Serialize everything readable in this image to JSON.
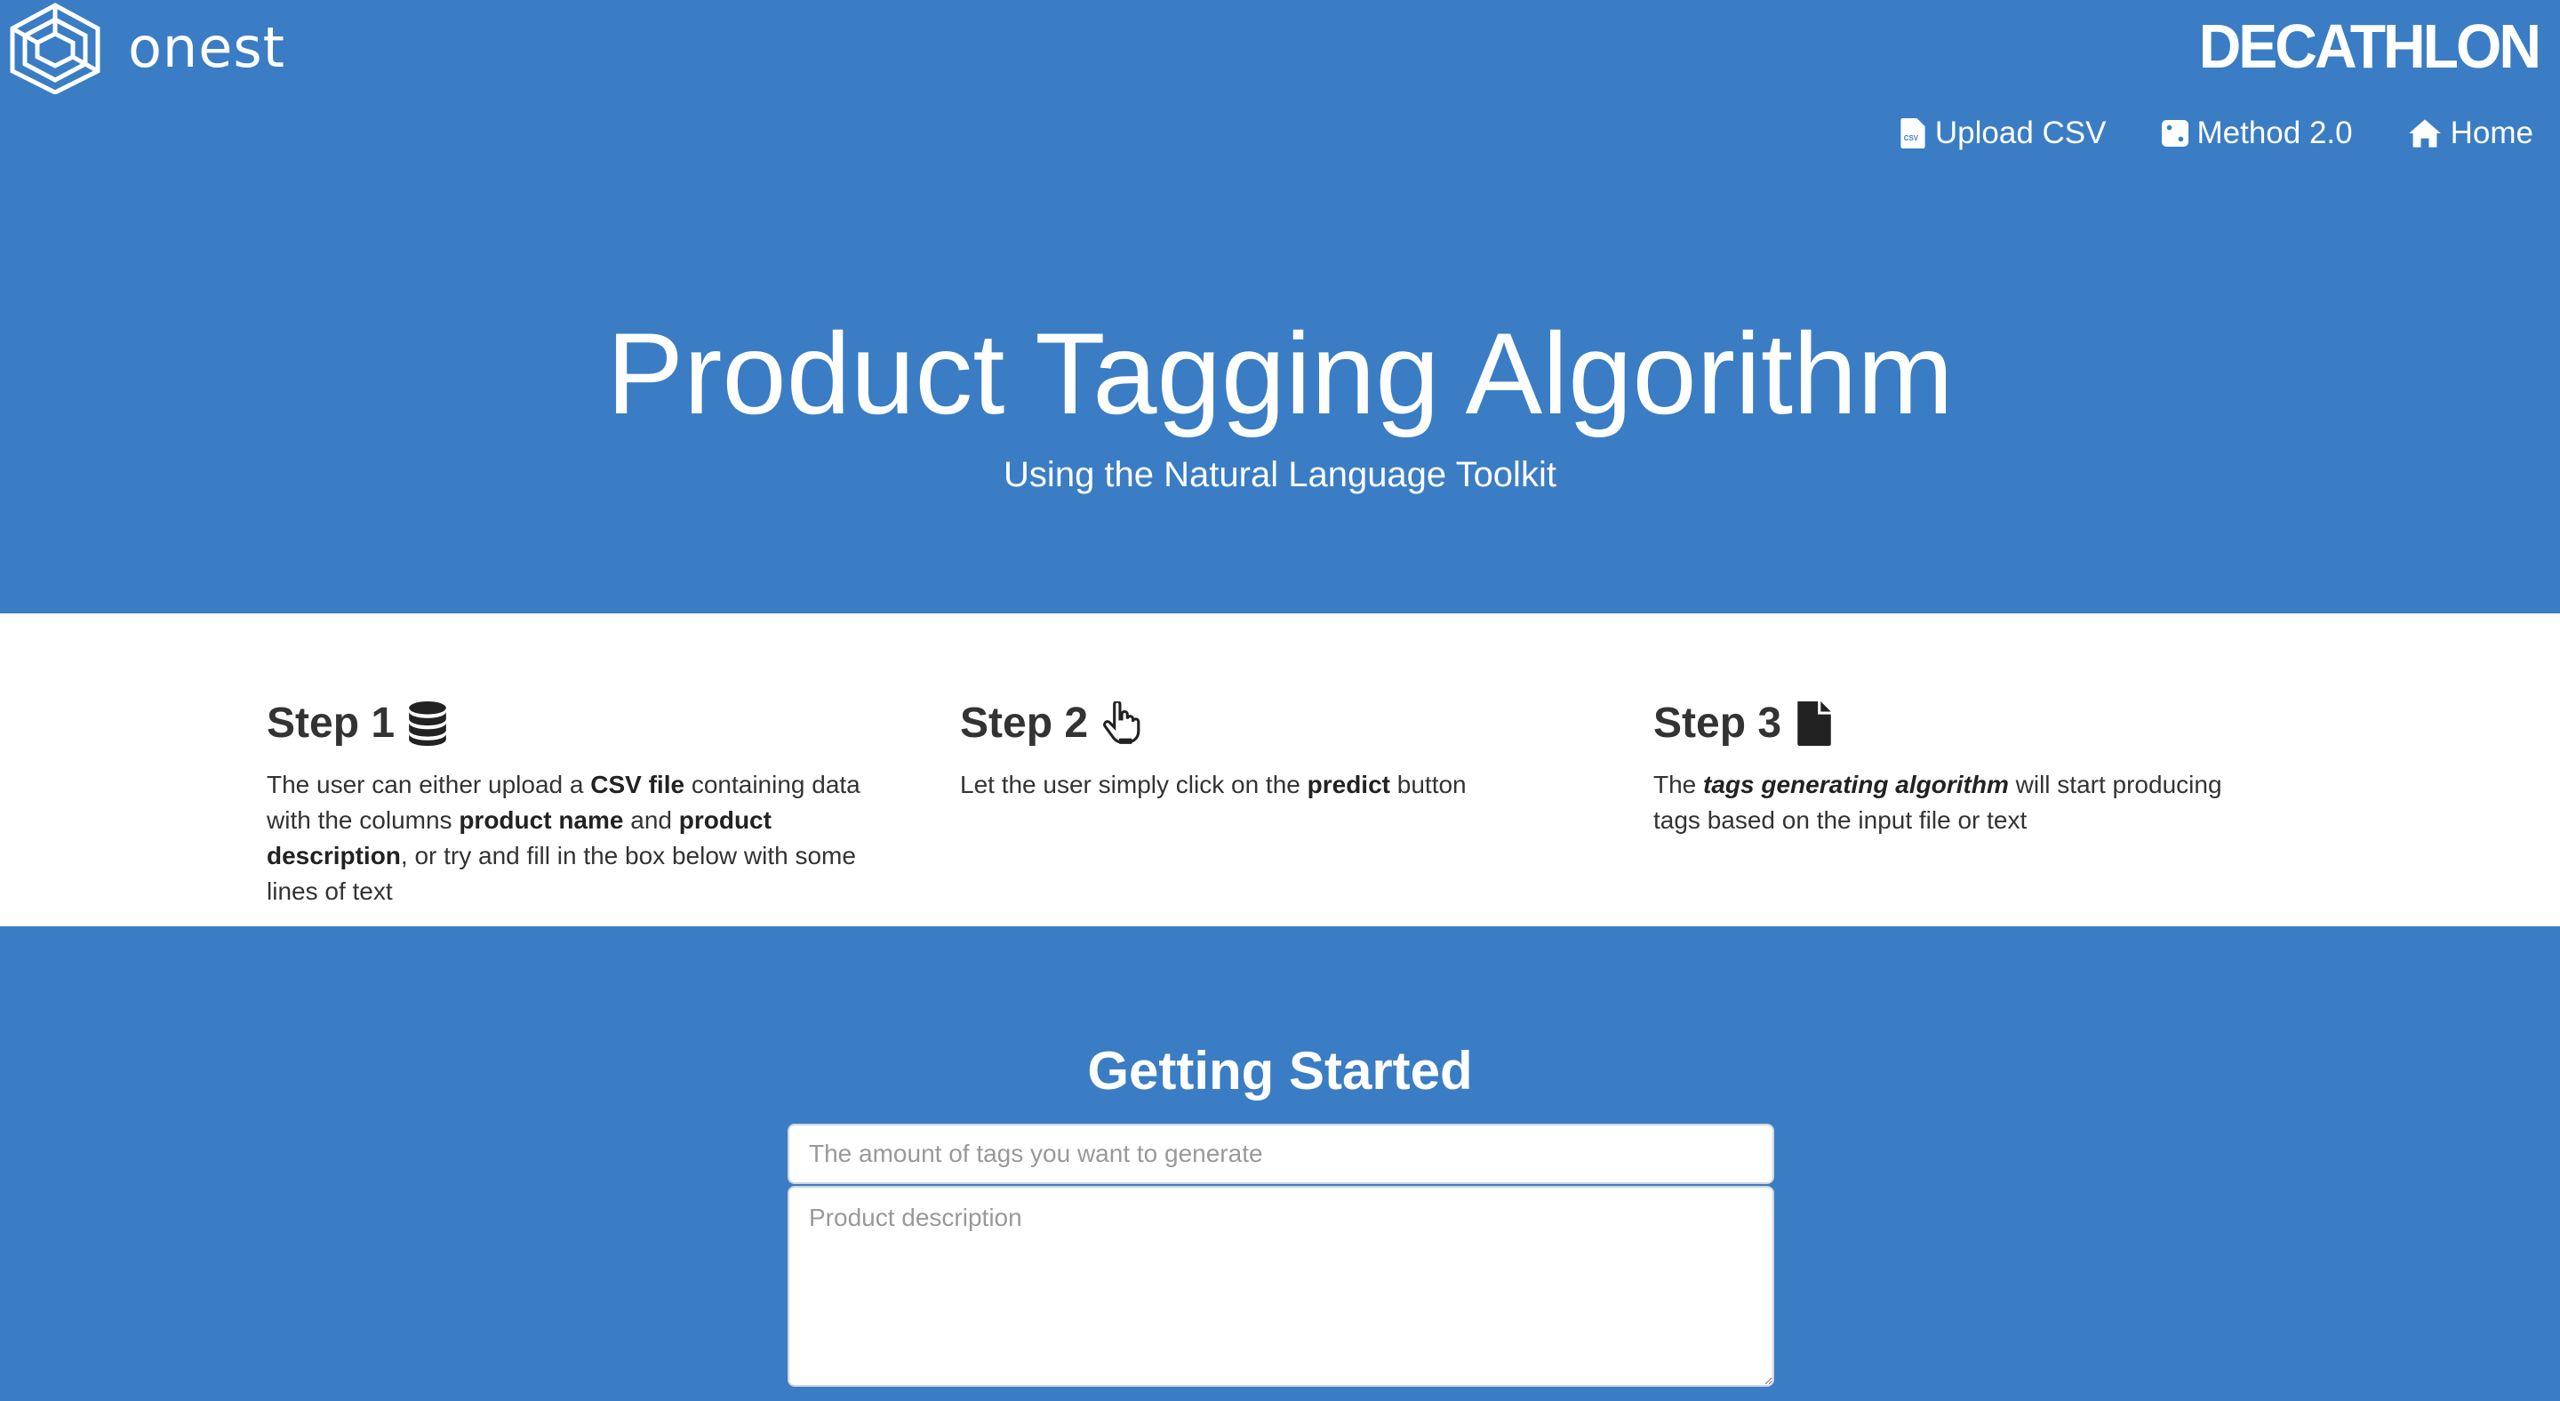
{
  "header": {
    "left_logo_text": "onest",
    "right_logo_text": "DECATHLON",
    "nav": [
      {
        "label": "Upload CSV",
        "icon": "csv-file-icon"
      },
      {
        "label": "Method 2.0",
        "icon": "dice-icon"
      },
      {
        "label": "Home",
        "icon": "home-icon"
      }
    ]
  },
  "hero": {
    "title": "Product Tagging Algorithm",
    "subtitle": "Using the Natural Language Toolkit"
  },
  "steps": [
    {
      "title": "Step 1",
      "icon": "database-icon",
      "text_parts": [
        "The user can either upload a ",
        "CSV file",
        " containing data with the columns ",
        "product name",
        " and ",
        "product description",
        ", or try and fill in the box below with some lines of text"
      ]
    },
    {
      "title": "Step 2",
      "icon": "pointer-hand-icon",
      "text_parts": [
        "Let the user simply click on the ",
        "predict",
        " button"
      ]
    },
    {
      "title": "Step 3",
      "icon": "file-icon",
      "text_parts": [
        "The ",
        "tags generating algorithm",
        " will start producing tags based on the input file or text"
      ]
    }
  ],
  "getting_started": {
    "heading": "Getting Started",
    "tags_placeholder": "The amount of tags you want to generate",
    "description_placeholder": "Product description"
  },
  "colors": {
    "brand_blue": "#3a7dc4",
    "white": "#ffffff"
  }
}
